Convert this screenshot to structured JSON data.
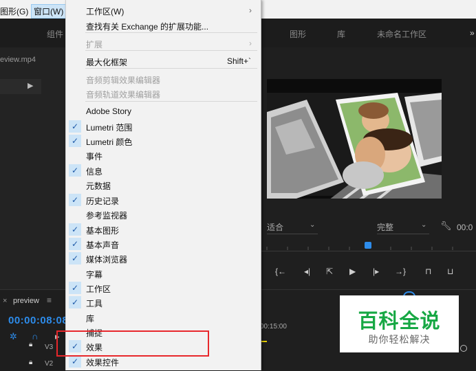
{
  "menubar": {
    "graphics": "图形(G)",
    "window": "窗口(W)"
  },
  "workspaces": {
    "assembly": "组件",
    "graphics": "图形",
    "libraries": "库",
    "untitled": "未命名工作区"
  },
  "project": {
    "file": "eview.mp4"
  },
  "timeline": {
    "close": "×",
    "name": "preview",
    "menu": "≡",
    "timecode": "00:00:08:08",
    "track_v3": "V3",
    "track_v2": "V2",
    "ruler_time": "00:15:00"
  },
  "program": {
    "fit": "适合",
    "quality": "完整",
    "timecode": "00:0"
  },
  "menu": {
    "items": [
      {
        "label": "工作区(W)",
        "submenu": true
      },
      {
        "label": "查找有关 Exchange 的扩展功能..."
      },
      {
        "label": "扩展",
        "disabled": true,
        "submenu": true
      },
      {
        "label": "最大化框架",
        "shortcut": "Shift+`"
      },
      {
        "label": "音频剪辑效果编辑器",
        "disabled": true
      },
      {
        "label": "音频轨道效果编辑器",
        "disabled": true
      },
      {
        "label": "Adobe Story"
      },
      {
        "label": "Lumetri 范围",
        "checked": true
      },
      {
        "label": "Lumetri 颜色",
        "checked": true
      },
      {
        "label": "事件"
      },
      {
        "label": "信息",
        "checked": true
      },
      {
        "label": "元数据"
      },
      {
        "label": "历史记录",
        "checked": true
      },
      {
        "label": "参考监视器"
      },
      {
        "label": "基本图形",
        "checked": true
      },
      {
        "label": "基本声音",
        "checked": true
      },
      {
        "label": "媒体浏览器",
        "checked": true
      },
      {
        "label": "字幕"
      },
      {
        "label": "工作区",
        "checked": true
      },
      {
        "label": "工具",
        "checked": true
      },
      {
        "label": "库"
      },
      {
        "label": "捕捉"
      },
      {
        "label": "效果",
        "checked": true
      },
      {
        "label": "效果控件",
        "checked": true
      }
    ]
  },
  "watermark": {
    "title": "百科全说",
    "subtitle": "助你轻松解决"
  },
  "colors": {
    "accent": "#2d8ceb",
    "highlight": "#e8272b",
    "watermark": "#17a844"
  }
}
